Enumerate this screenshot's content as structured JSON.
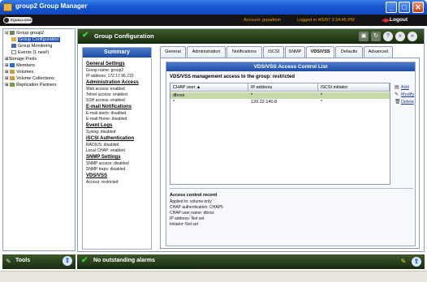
{
  "window": {
    "title": "group2 Group Manager",
    "min": "_",
    "max": "□",
    "close": "✕"
  },
  "header": {
    "logo": "EQUALLOGIC",
    "account": "Account: grpadmin",
    "logged_in": "Logged in 4/5/07 3:34:45 PM",
    "logout": "Logout"
  },
  "tree": {
    "items": [
      {
        "label": "Group group2",
        "expand": "⊟"
      },
      {
        "label": "Group Configuration"
      },
      {
        "label": "Group Monitoring"
      },
      {
        "label": "Events (1 new!)"
      },
      {
        "label": "Storage Pools",
        "expand": "⊞"
      },
      {
        "label": "Members",
        "expand": "⊞"
      },
      {
        "label": "Volumes",
        "expand": "⊞"
      },
      {
        "label": "Volume Collections",
        "expand": "⊞"
      },
      {
        "label": "Replication Partners",
        "expand": "⊞"
      }
    ]
  },
  "tools": {
    "label": "Tools"
  },
  "main": {
    "title": "Group Configuration"
  },
  "summary": {
    "title": "Summary",
    "sections": [
      {
        "heading": "General Settings",
        "lines": [
          "Group name: group2",
          "IP address: 172.17.96.210"
        ]
      },
      {
        "heading": "Administration Access",
        "lines": [
          "Web access: enabled",
          "Telnet access: enabled",
          "SSH access: enabled"
        ]
      },
      {
        "heading": "E-mail Notifications",
        "lines": [
          "E-mail alerts: disabled",
          "E-mail Home: disabled"
        ]
      },
      {
        "heading": "Event Logs",
        "lines": [
          "Syslog: disabled"
        ]
      },
      {
        "heading": "iSCSI Authentication",
        "lines": [
          "RADIUS: disabled",
          "Local CHAP: enabled"
        ]
      },
      {
        "heading": "SNMP Settings",
        "lines": [
          "SNMP access: disabled",
          "SNMP traps: disabled"
        ]
      },
      {
        "heading": "VDS/VSS",
        "lines": [
          "Access: restricted"
        ]
      }
    ]
  },
  "tabs": [
    "General",
    "Administration",
    "Notifications",
    "iSCSI",
    "SNMP",
    "VDS/VSS",
    "Defaults",
    "Advanced"
  ],
  "acl": {
    "title": "VDS/VSS Access Control List",
    "management": "VDS/VSS management access to the group:  restricted",
    "columns": [
      "CHAP user ▲",
      "IP address",
      "iSCSI initiator"
    ],
    "rows": [
      [
        "dbvss",
        "*",
        "*"
      ],
      [
        "*",
        "120.22.140.8",
        "*"
      ]
    ],
    "actions": [
      "Add",
      "Modify",
      "Delete"
    ]
  },
  "record": {
    "title": "Access control record",
    "lines": [
      "Applied to:  volume only",
      "CHAP authentication:  CHAP5",
      "CHAP user name: dbvss",
      "IP address:  Not set",
      "Initiator:  Not set"
    ]
  },
  "alarms": {
    "label": "No outstanding alarms"
  },
  "colors": {
    "titlebar": "#1455d0",
    "panel_header": "#2a4020",
    "accent": "#e8a000"
  }
}
